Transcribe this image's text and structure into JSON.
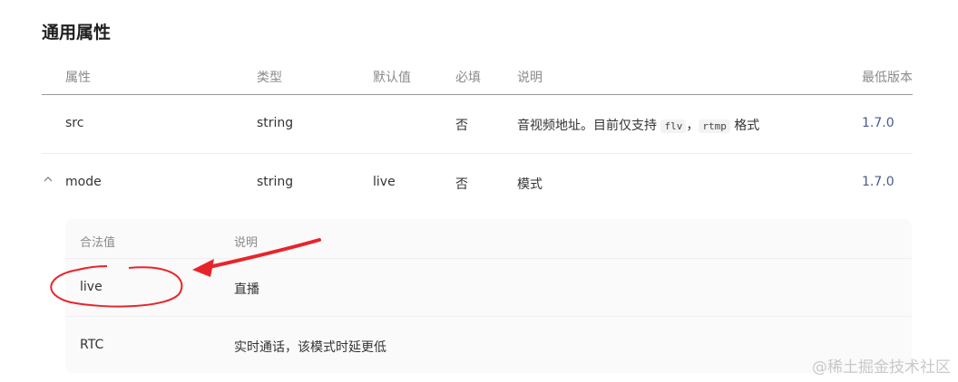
{
  "section": {
    "title": "通用属性"
  },
  "table": {
    "headers": {
      "name": "属性",
      "type": "类型",
      "default": "默认值",
      "required": "必填",
      "description": "说明",
      "min_version": "最低版本"
    },
    "rows": [
      {
        "name": "src",
        "type": "string",
        "default": "",
        "required": "否",
        "description_prefix": "音视频地址。目前仅支持 ",
        "code1": "flv",
        "separator": "，",
        "code2": "rtmp",
        "description_suffix": " 格式",
        "min_version": "1.7.0"
      },
      {
        "name": "mode",
        "type": "string",
        "default": "live",
        "required": "否",
        "description": "模式",
        "min_version": "1.7.0",
        "expanded": true,
        "chevron": "^"
      }
    ]
  },
  "subtable": {
    "headers": {
      "value": "合法值",
      "description": "说明"
    },
    "rows": [
      {
        "value": "live",
        "description": "直播"
      },
      {
        "value": "RTC",
        "description": "实时通话，该模式时延更低"
      }
    ]
  },
  "annotation": {
    "color": "#e8242b"
  },
  "watermark": "@稀土掘金技术社区",
  "colors": {
    "version_link": "#4a5a8c",
    "header_text": "#8a8a8a",
    "subtable_bg": "#fafafa"
  }
}
